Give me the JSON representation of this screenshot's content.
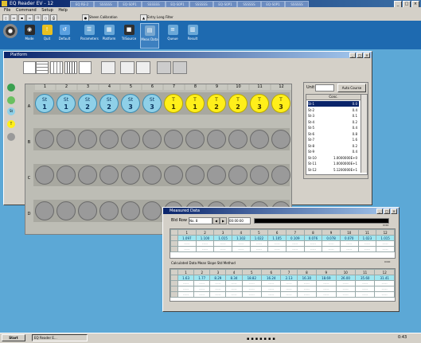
{
  "app": {
    "title": "EQ Reader EV - 12",
    "title_segments": [
      "EQ RE-2",
      "SSSSSS",
      "EQ-S0P1",
      "SSSSSS",
      "EQ-S0P1",
      "SSSSSS",
      "EQ-S0P1",
      "SSSSSS",
      "EQ-S0P1",
      "SSSSSS"
    ]
  },
  "menu": [
    "File",
    "Command",
    "Setup",
    "Help"
  ],
  "toolbar1": {
    "label_a": "Sheen Calibration",
    "label_b": "Entry Long Filter"
  },
  "toolbar2": [
    {
      "label": "Mode",
      "color": "#2a2a2a"
    },
    {
      "label": "Quit",
      "color": "#e8c020"
    },
    {
      "label": "Default",
      "color": "#5aa0e0"
    },
    {
      "label": "Parameters",
      "color": "#6aa8d8"
    },
    {
      "label": "Platform",
      "color": "#6aa8d8"
    },
    {
      "label": "TriSource",
      "color": "#303030"
    },
    {
      "label": "Meas Data",
      "color": "#7aa8d0"
    },
    {
      "label": "Queue",
      "color": "#6aa8d8"
    },
    {
      "label": "Result",
      "color": "#6aa8d8"
    }
  ],
  "platform": {
    "title": "Platform",
    "col_headers": [
      "1",
      "2",
      "3",
      "4",
      "5",
      "6",
      "7",
      "8",
      "9",
      "10",
      "11",
      "12"
    ],
    "row_headers": [
      "A",
      "B",
      "C",
      "D"
    ],
    "row_a": [
      {
        "type": "st",
        "l1": "St",
        "l2": "1"
      },
      {
        "type": "st",
        "l1": "St",
        "l2": "1"
      },
      {
        "type": "st",
        "l1": "St",
        "l2": "2"
      },
      {
        "type": "st",
        "l1": "St",
        "l2": "2"
      },
      {
        "type": "st",
        "l1": "St",
        "l2": "3"
      },
      {
        "type": "st",
        "l1": "St",
        "l2": "3"
      },
      {
        "type": "t",
        "l1": "T",
        "l2": "1"
      },
      {
        "type": "t",
        "l1": "T",
        "l2": "1"
      },
      {
        "type": "t",
        "l1": "T",
        "l2": "2"
      },
      {
        "type": "t",
        "l1": "T",
        "l2": "2"
      },
      {
        "type": "t",
        "l1": "T",
        "l2": "3"
      },
      {
        "type": "t",
        "l1": "T",
        "l2": "3"
      }
    ],
    "side_panel": {
      "unit_label": "Unit",
      "auto_button": "Auto Course",
      "table_header": "Conc.",
      "rows": [
        {
          "k": "St-1",
          "v": "0.0"
        },
        {
          "k": "St-2",
          "v": "0.4"
        },
        {
          "k": "St-3",
          "v": "0.1"
        },
        {
          "k": "St-4",
          "v": "0.2"
        },
        {
          "k": "St-5",
          "v": "0.4"
        },
        {
          "k": "St-6",
          "v": "0.8"
        },
        {
          "k": "St-7",
          "v": "1.6"
        },
        {
          "k": "St-8",
          "v": "0.2"
        },
        {
          "k": "St-9",
          "v": "0.4"
        },
        {
          "k": "St-10",
          "v": "1.0000000E+0"
        },
        {
          "k": "St-11",
          "v": "1.0000000E+1"
        },
        {
          "k": "St-12",
          "v": "5.1200000E+1"
        }
      ]
    }
  },
  "measured": {
    "title": "Measured Data",
    "ctrl_label": "Bld Row",
    "ctrl_value": "No. 8",
    "time_value": "00:00:00",
    "header_row": [
      "1",
      "2",
      "3",
      "4",
      "5",
      "6",
      "7",
      "8",
      "9",
      "10",
      "11",
      "12"
    ],
    "row1": [
      "1.097",
      "1.100",
      "1.015",
      "1.102",
      "1.022",
      "1.105",
      "0.109",
      "0.076",
      "0.078",
      "0.070",
      "1.023",
      "1.015"
    ],
    "row_blank": [
      "-----",
      "-----",
      "-----",
      "-----",
      "-----",
      "-----",
      "-----",
      "-----",
      "-----",
      "-----",
      "-----",
      "-----"
    ],
    "calc_label": "Calculated Data  Mean Slope Std Method",
    "row2": [
      "1.63",
      "1.77",
      "8.29",
      "8.34",
      "18.82",
      "16.24",
      "2.13",
      "16.30",
      "18.69",
      "26.00",
      "35.60",
      "31.41"
    ]
  },
  "taskbar": {
    "start": "Start",
    "task1": "EQ Reader E...",
    "clock": "0:43"
  }
}
